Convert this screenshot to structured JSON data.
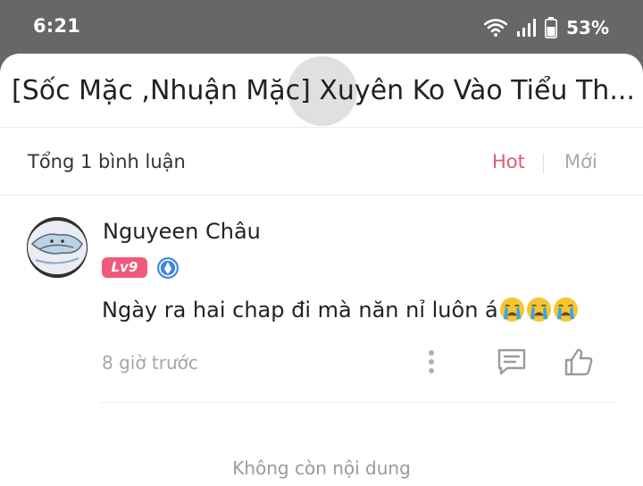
{
  "status_bar": {
    "time": "6:21",
    "battery_percent": "53%",
    "icons": [
      "wifi-icon",
      "signal-icon",
      "battery-icon"
    ]
  },
  "post": {
    "title": "[Sốc Mặc ,Nhuận Mặc] Xuyên Ko Vào Tiểu Th..."
  },
  "comments_header": {
    "count_label": "Tổng 1 bình luận",
    "sort_options": [
      "Hot",
      "Mới"
    ],
    "active_sort": "Hot"
  },
  "comments": [
    {
      "username": "Nguyeen Châu",
      "level": "Lv9",
      "text": "Ngày ra hai chap đi mà năn nỉ luôn á",
      "emojis": [
        "crying-face",
        "crying-face",
        "crying-face"
      ],
      "time": "8 giờ trước"
    }
  ],
  "footer": {
    "end_message": "Không còn nội dung"
  },
  "colors": {
    "accent": "#e05a72",
    "level_badge": "#ef5a7a",
    "medal": "#3f8ad8",
    "scrim": "#676767"
  }
}
